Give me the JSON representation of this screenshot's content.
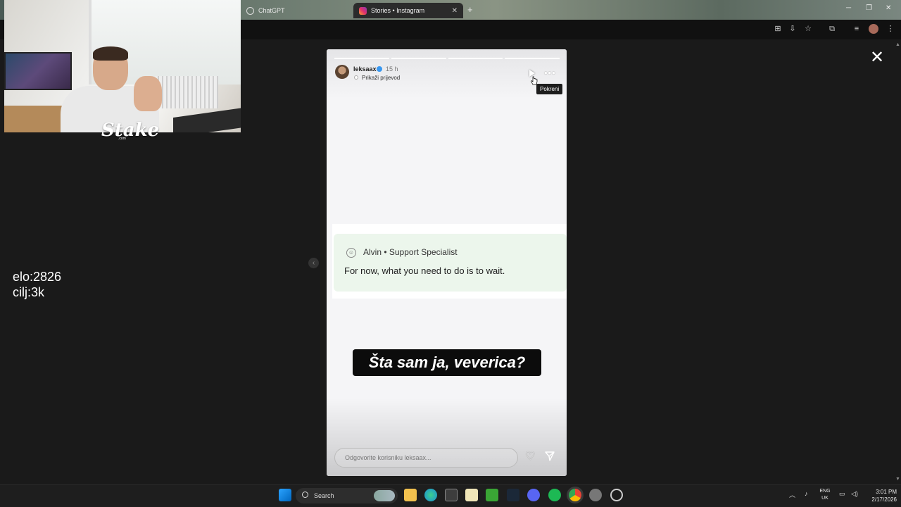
{
  "browser": {
    "tabs": [
      {
        "label": "ChatGPT"
      },
      {
        "label": "Stories • Instagram"
      }
    ],
    "new_tab_symbol": "+",
    "tab_close_symbol": "✕"
  },
  "overlay": {
    "elo_line": "elo:2826",
    "goal_line": "cilj:3k"
  },
  "story": {
    "username": "leksaax",
    "time_ago": "15 h",
    "translate_label": "Prikaži prijevod",
    "tooltip": "Pokreni",
    "more_symbol": "•••",
    "chat": {
      "agent_name": "Alvin • Support Specialist",
      "message": "For now, what you need to do is to wait."
    },
    "caption": "Šta sam ja, veverica?",
    "reply_placeholder": "Odgovorite korisniku leksaax...",
    "progress_segments": 4,
    "close_symbol": "✕",
    "prev_symbol": "‹"
  },
  "taskbar": {
    "search_label": "Search",
    "lang_top": "ENG",
    "lang_bottom": "UK",
    "time": "3:01 PM",
    "date": "2/17/2026"
  },
  "colors": {
    "verified": "#3897f0",
    "chat_card": "#ecf6ec",
    "caption_bg": "#0c0c0c",
    "taskbar_bg": "#1e1e1e"
  },
  "icons": [
    "chatgpt-icon",
    "instagram-icon",
    "translate-icon",
    "install-icon",
    "star-icon",
    "extensions-icon",
    "media-icon",
    "profile-icon",
    "menu-icon",
    "play-icon",
    "more-icon",
    "heart-icon",
    "send-icon",
    "close-icon",
    "windows-start-icon",
    "search-icon"
  ]
}
